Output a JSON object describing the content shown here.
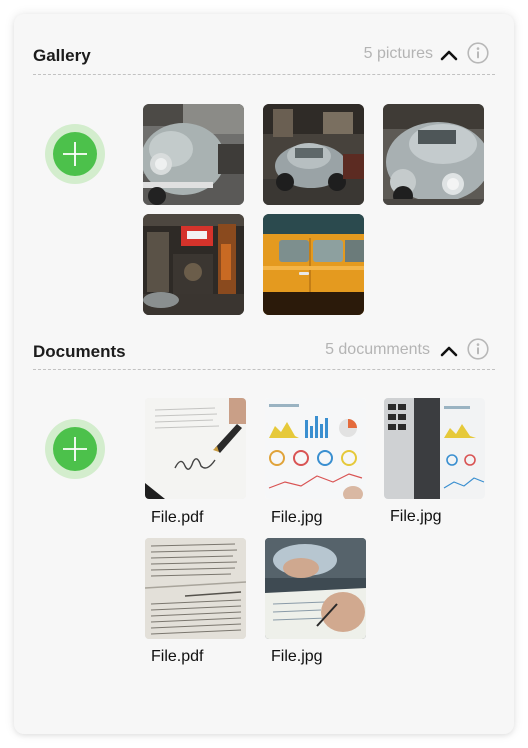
{
  "gallery": {
    "title": "Gallery",
    "count": "5 pictures",
    "collapse_icon": "chevron-up-icon",
    "info_icon": "info-icon",
    "add_icon": "plus-icon",
    "photos": [
      {
        "subject": "silver beetle front"
      },
      {
        "subject": "silver beetle in garage"
      },
      {
        "subject": "silver beetle close-up"
      },
      {
        "subject": "garage interior with sign"
      },
      {
        "subject": "orange classic car"
      }
    ]
  },
  "documents": {
    "title": "Documents",
    "count": "5 documments",
    "collapse_icon": "chevron-up-icon",
    "info_icon": "info-icon",
    "add_icon": "plus-icon",
    "files": [
      {
        "name": "File.pdf"
      },
      {
        "name": "File.jpg"
      },
      {
        "name": "File.jpg"
      },
      {
        "name": "File.pdf"
      },
      {
        "name": "File.jpg"
      }
    ]
  },
  "colors": {
    "accent_green": "#4cc14b",
    "accent_green_light": "#d3edcd",
    "muted_text": "#b4b4b4"
  }
}
